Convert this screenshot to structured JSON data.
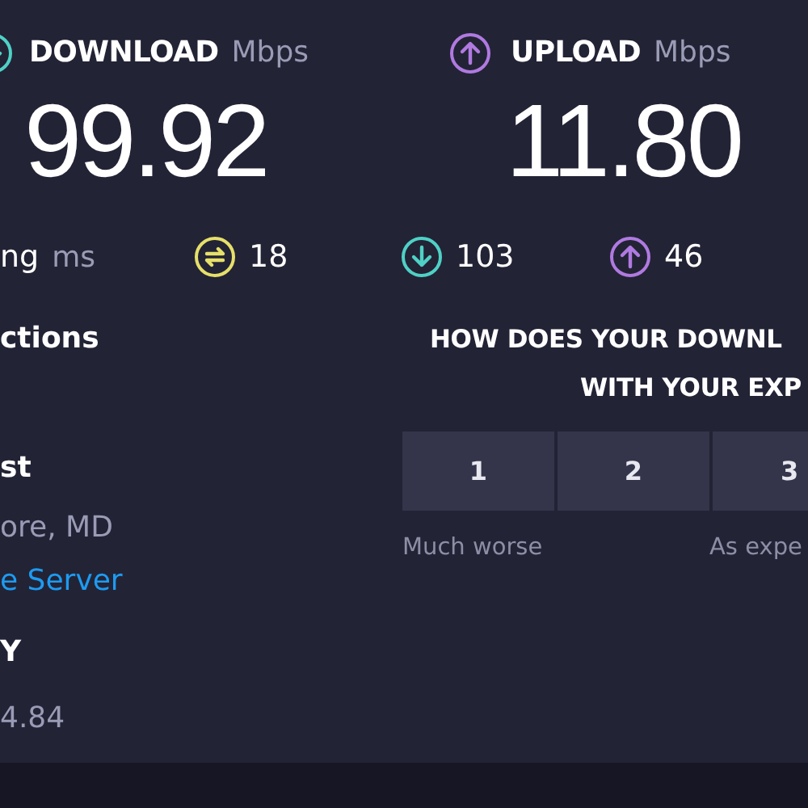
{
  "download": {
    "label": "DOWNLOAD",
    "unit": "Mbps",
    "value": "99.92"
  },
  "upload": {
    "label": "UPLOAD",
    "unit": "Mbps",
    "value": "11.80"
  },
  "ping": {
    "label": "ng",
    "unit": "ms"
  },
  "latency": [
    {
      "kind": "jitter",
      "value": "18"
    },
    {
      "kind": "download",
      "value": "103"
    },
    {
      "kind": "upload",
      "value": "46"
    }
  ],
  "connections": {
    "label": "ctions"
  },
  "host": {
    "label": "st",
    "location": "ore, MD",
    "link": "e Server"
  },
  "isp": {
    "label": "Y",
    "ip": "4.84"
  },
  "survey": {
    "question_lines": [
      "HOW DOES YOUR DOWNL",
      "WITH YOUR EXP"
    ],
    "options": [
      "1",
      "2",
      "3"
    ],
    "scale_labels": [
      "Much worse",
      "As expe"
    ]
  }
}
